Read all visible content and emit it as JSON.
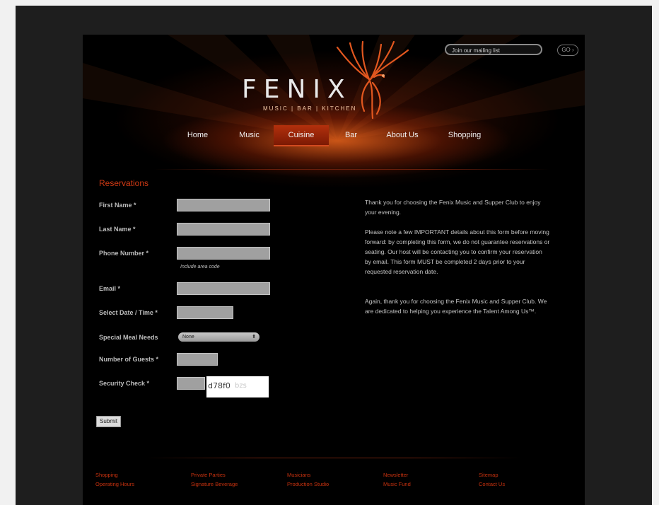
{
  "header": {
    "logo_text": "FENIX",
    "tagline": "MUSIC | BAR | KITCHEN",
    "mailing_placeholder": "Join our mailing list",
    "go_label": "GO ›"
  },
  "nav": {
    "items": [
      {
        "label": "Home"
      },
      {
        "label": "Music"
      },
      {
        "label": "Cuisine"
      },
      {
        "label": "Bar"
      },
      {
        "label": "About Us"
      },
      {
        "label": "Shopping"
      }
    ],
    "active": "Cuisine"
  },
  "form": {
    "title": "Reservations",
    "first_name_label": "First Name *",
    "last_name_label": "Last Name *",
    "phone_label": "Phone Number *",
    "phone_hint": "Include area code",
    "email_label": "Email *",
    "date_label": "Select Date / Time *",
    "meal_label": "Special Meal Needs",
    "meal_selected": "None",
    "guests_label": "Number of Guests *",
    "security_label": "Security Check *",
    "captcha_code": "d78f0",
    "captcha_noise": "bzs",
    "submit_label": "Submit"
  },
  "info": {
    "p1": "Thank you for choosing the Fenix Music and Supper Club to enjoy your evening.",
    "p2": "Please note a few IMPORTANT details about this form before moving forward: by completing this form, we do not guarantee reservations or seating. Our host will be contacting you to confirm your reservation by email. This form MUST be completed 2 days prior to your requested reservation date.",
    "p3": "Again, thank you for choosing the Fenix Music and Supper Club. We are dedicated to helping you experience the Talent Among Us™."
  },
  "footer": {
    "links": [
      [
        "Shopping",
        "Operating Hours"
      ],
      [
        "Private Parties",
        "Signature Beverage"
      ],
      [
        "Musicians",
        "Production Studio"
      ],
      [
        "Newsletter",
        "Music Fund"
      ],
      [
        "Sitemap",
        "Contact Us"
      ]
    ]
  },
  "colors": {
    "accent": "#d23a14",
    "background": "#000000",
    "field": "#a0a0a0"
  }
}
